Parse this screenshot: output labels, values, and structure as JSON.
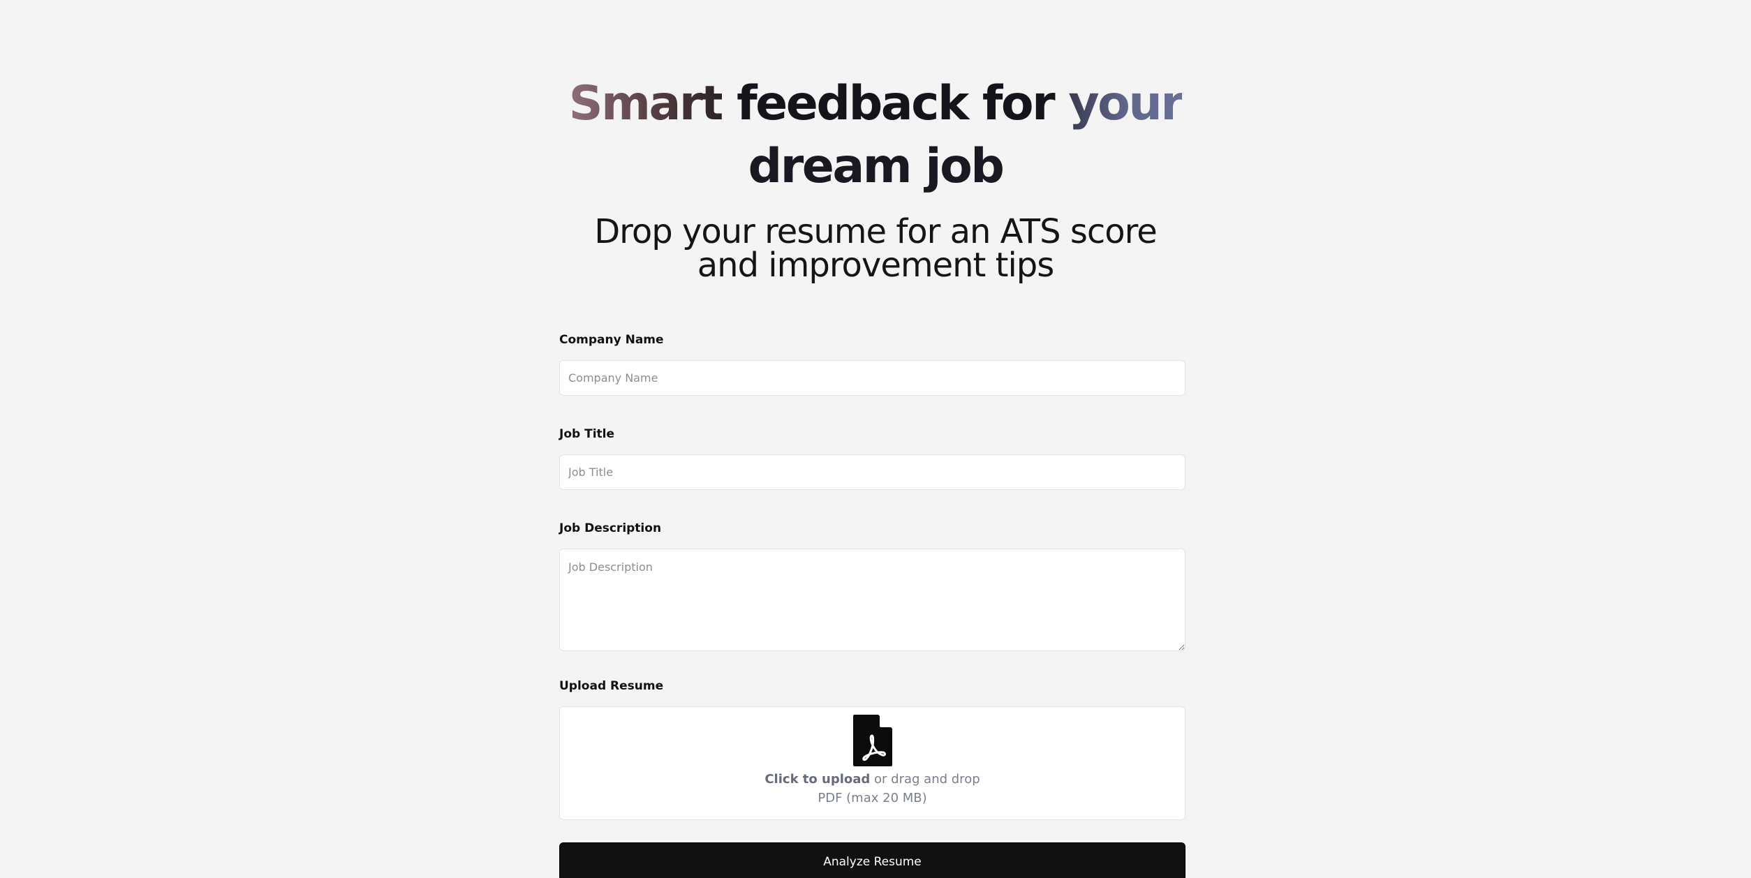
{
  "hero": {
    "title_part1": "Smart",
    "title_part2": " feedback for ",
    "title_part3": "your",
    "title_line2": "dream job",
    "subtitle_line1": "Drop your resume for an ATS score",
    "subtitle_line2": "and improvement tips"
  },
  "form": {
    "company": {
      "label": "Company Name",
      "placeholder": "Company Name"
    },
    "job_title": {
      "label": "Job Title",
      "placeholder": "Job Title"
    },
    "job_description": {
      "label": "Job Description",
      "placeholder": "Job Description"
    },
    "upload": {
      "label": "Upload Resume",
      "icon": "pdf-file-icon",
      "click_text": "Click to upload",
      "drag_text": " or drag and drop",
      "hint": "PDF (max 20 MB)"
    },
    "submit_label": "Analyze Resume"
  },
  "colors": {
    "background": "#f4f4f4",
    "button": "#111111",
    "gradient_start": "#8e6f78",
    "gradient_end": "#6a6f96"
  }
}
